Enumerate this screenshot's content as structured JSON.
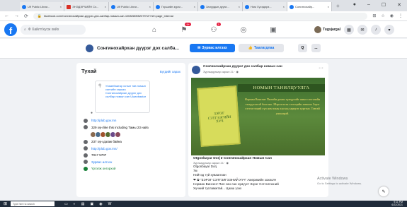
{
  "browser": {
    "tabs": [
      {
        "label": "Ulf Public Librar...",
        "fav": "fb"
      },
      {
        "label": "ЭНЭДЭРЧИЙН Сэ...",
        "fav": "red"
      },
      {
        "label": "Ulf Public Librar...",
        "fav": "fb"
      },
      {
        "label": "Гэршийн зураг...",
        "fav": "fb"
      },
      {
        "label": "Залуудын дууги...",
        "fav": "fb"
      },
      {
        "label": "Ном Хүсэдэрэ...",
        "fav": "fb"
      },
      {
        "label": "Сонгинохайр...",
        "fav": "fb",
        "active": true
      }
    ],
    "new_tab": "+",
    "url": "facebook.com/Сонгинохайрхан-дүүрэг-дэх-салбар-номын-сан-10082805520797​2/?ref=page_internal"
  },
  "facebook": {
    "search_placeholder": "Ф Хайлт/хусж хийх",
    "badges": {
      "pages": "9+",
      "groups": "1"
    },
    "profile_name": "Tugsjargal"
  },
  "page_header": {
    "name": "Сонгинохайрхан дүүрэг дэх салба...",
    "message_label": "Зурвас илгээх",
    "like_label": "Таалагдлаа",
    "search_glyph": "Q",
    "more_glyph": "..."
  },
  "sidebar": {
    "title": "Тухай",
    "see_all": "Бүгдийг харах",
    "address": "Улаанбаатар хотын төв номын сангийн харьяа Сонгинохайрхан дүүрэг дэх салбар номын сан Ulaanbaatar",
    "info_rows": [
      {
        "text": "http://plub.gov.mn",
        "kind": "link"
      },
      {
        "text": "329 хүн like this including Тамы 23 найз",
        "kind": "text"
      },
      {
        "text": "",
        "kind": "faces"
      },
      {
        "text": "237 хүн дагаж байна",
        "kind": "text"
      },
      {
        "text": "http://plub.gov.mn/",
        "kind": "link"
      },
      {
        "text": "7017 5707",
        "kind": "text"
      },
      {
        "text": "Зурвас илгээх",
        "kind": "link"
      },
      {
        "text": "Үргэлж онгорхой",
        "kind": "green"
      }
    ]
  },
  "post": {
    "page_name": "Сонгинохайрхан дүүрэг дэх салбар номын сан",
    "time": "Зургаадугаар сарын 21 · ◉",
    "image": {
      "banner": "НОМЫН ТАНИЛЦУУЛГА",
      "book_title": "ЗЭРЭГ СЭТГЭЭГИЙН ХҮЧ",
      "text": "Норман Винсент Пилийн дахин хүмүүсийг шинэ сэтгэлийн тэмүүлэлтэй болгоно. Мэрэлгэсэн сэтгэцийн хэвшил Зэрэг сэтгэлгээний хүч ном таны хүсэлд хариулт хүргэнэ. Тавтай уншаарай."
    },
    "author": "Otgonbayar Dorj ▸ Сонгинохайрхан Номын Сан",
    "meta": "Зургаадугаар сарын 21 · ◉",
    "lines": [
      {
        "text": "Otgonbayar Dorj",
        "kind": "text"
      },
      {
        "text": "7м",
        "kind": "text"
      },
      {
        "text": "Нийтэд түй хувааллан",
        "kind": "text"
      },
      {
        "text": "❤ ✿ \"ЗЭРЭГ СЭТГЭЛГЭЭНИЙ ХҮЧ\" Америкийн зохиолч",
        "kind": "text"
      },
      {
        "text": "Норман Винсент Пил сан сан хүмүүст Зэрэг Сэтгэлгээний",
        "kind": "text"
      },
      {
        "text": "Хүчний тусламжтай... Цааш үзэх",
        "kind": "text"
      }
    ]
  },
  "windows": {
    "activate_title": "Activate Windows",
    "activate_sub": "Go to Settings to activate Windows.",
    "taskbar_search": "Type here to search",
    "time": "9:11 PM",
    "date": "6/22/2021"
  }
}
